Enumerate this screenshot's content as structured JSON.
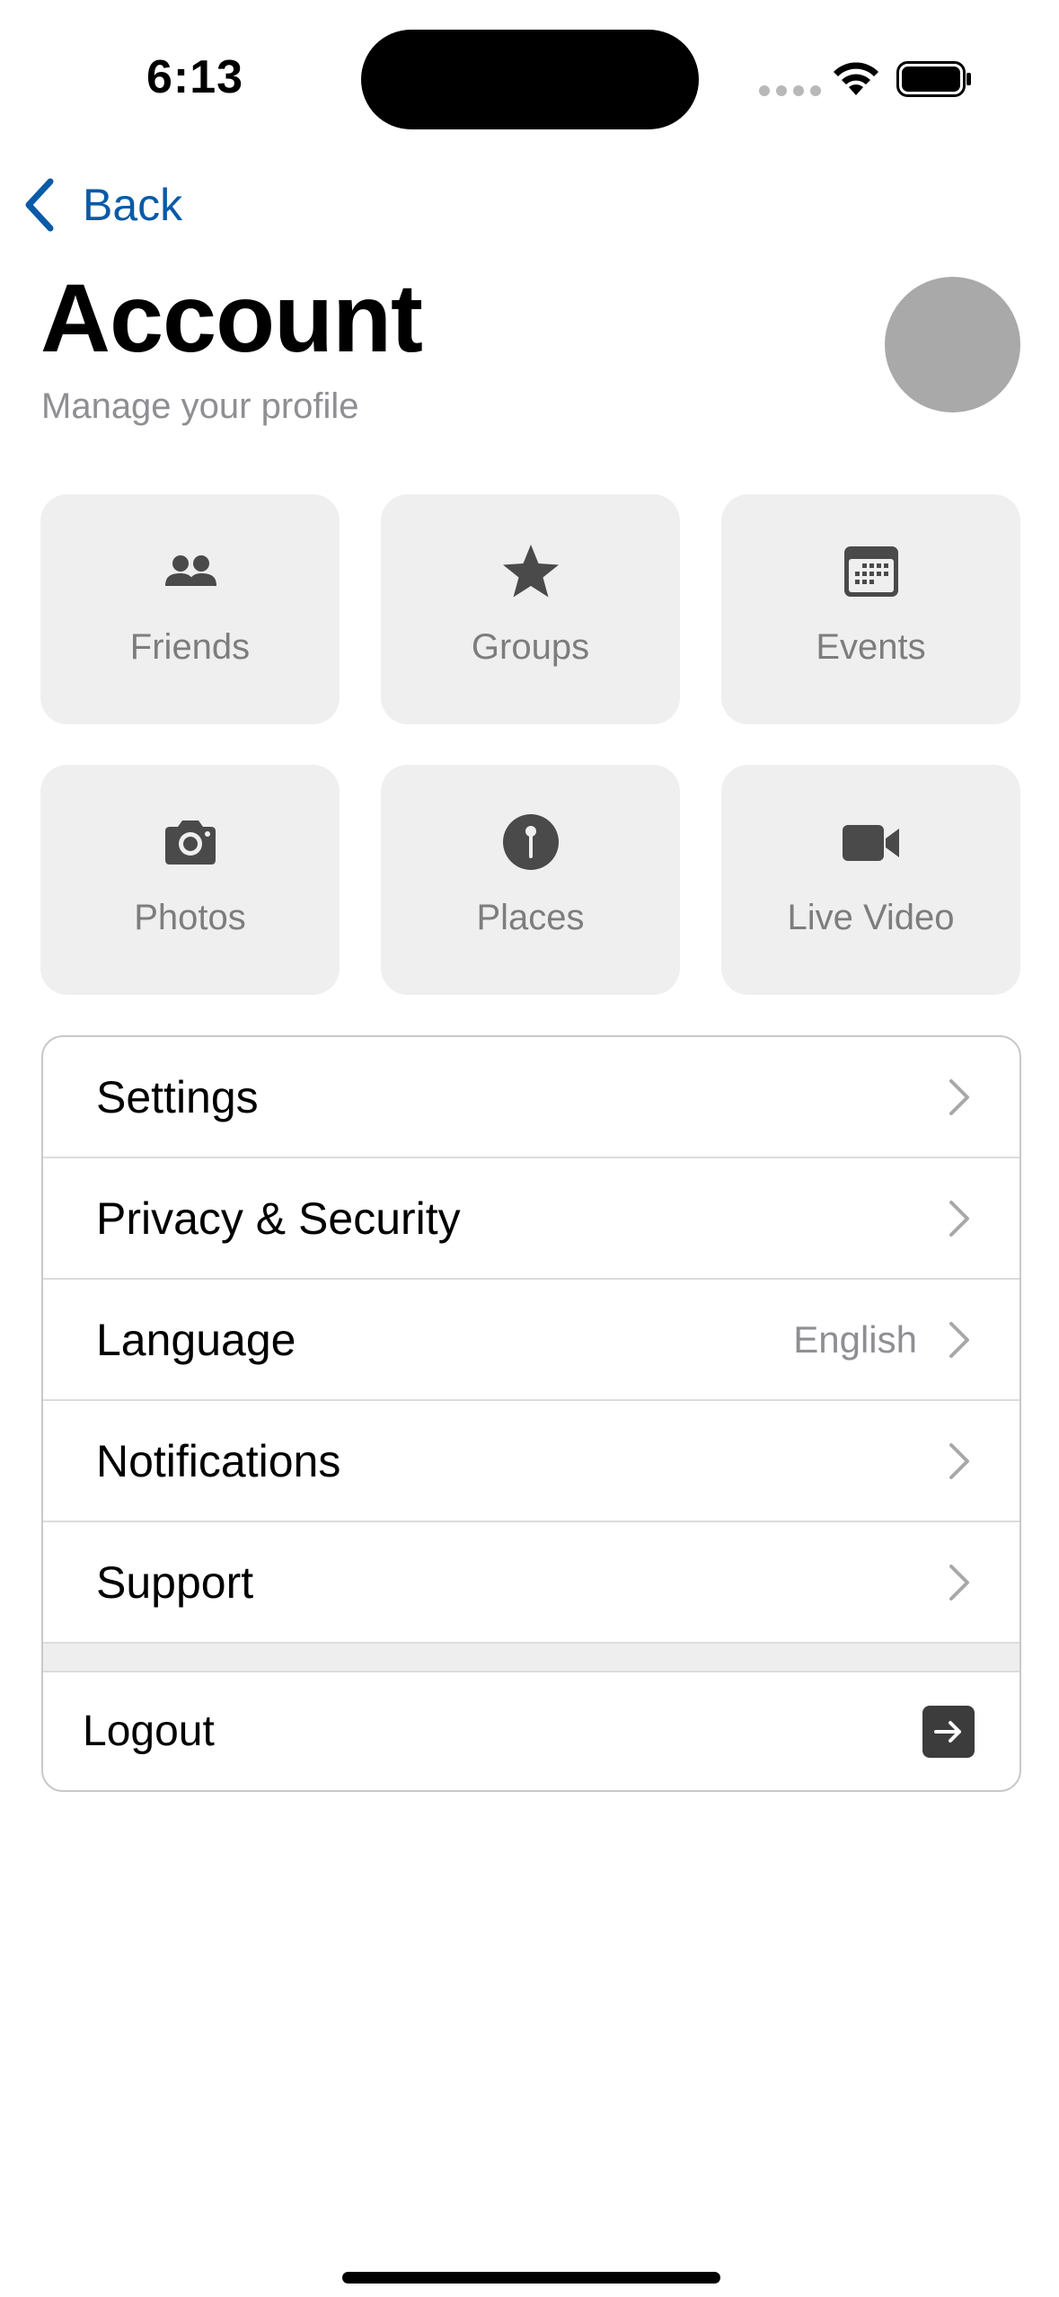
{
  "status_bar": {
    "time": "6:13"
  },
  "nav": {
    "back_label": "Back",
    "back_color": "#0a5aa6"
  },
  "header": {
    "title": "Account",
    "subtitle": "Manage your profile"
  },
  "tiles": [
    {
      "label": "Friends",
      "icon": "people-icon"
    },
    {
      "label": "Groups",
      "icon": "star-icon"
    },
    {
      "label": "Events",
      "icon": "calendar-icon"
    },
    {
      "label": "Photos",
      "icon": "camera-icon"
    },
    {
      "label": "Places",
      "icon": "pin-icon"
    },
    {
      "label": "Live Video",
      "icon": "video-icon"
    }
  ],
  "settings": {
    "items": [
      {
        "label": "Settings",
        "value": ""
      },
      {
        "label": "Privacy & Security",
        "value": ""
      },
      {
        "label": "Language",
        "value": "English"
      },
      {
        "label": "Notifications",
        "value": ""
      },
      {
        "label": "Support",
        "value": ""
      }
    ],
    "logout_label": "Logout"
  },
  "colors": {
    "tile_background": "#efefef",
    "icon": "#4a4a4a",
    "secondary_text": "#8e8e93"
  }
}
